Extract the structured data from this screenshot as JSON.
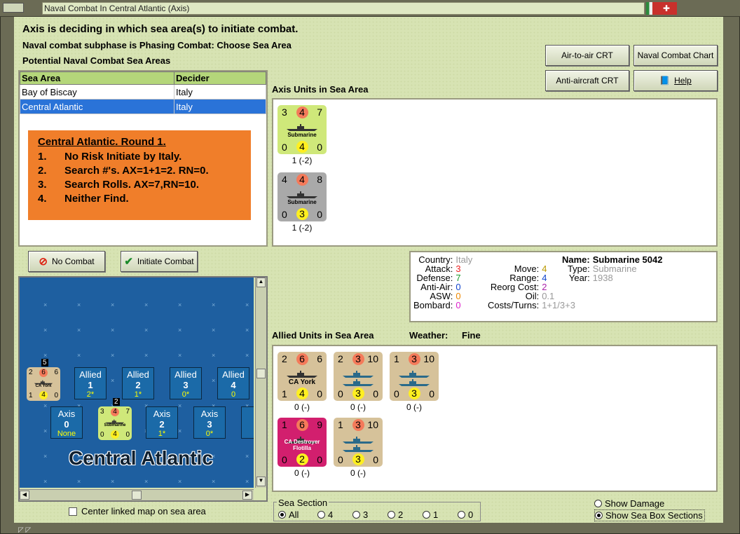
{
  "window": {
    "title": "Naval Combat In Central Atlantic (Axis)"
  },
  "status": {
    "line1": "Axis is deciding in which sea area(s) to initiate combat.",
    "line2": "Naval combat subphase is Phasing Combat: Choose Sea Area",
    "line3": "Potential Naval Combat Sea Areas"
  },
  "buttons": {
    "air_crt": "Air-to-air CRT",
    "naval_chart": "Naval Combat Chart",
    "aa_crt": "Anti-aircraft CRT",
    "help": "Help",
    "no_combat": "No Combat",
    "initiate": "Initiate Combat"
  },
  "sea_table": {
    "headers": [
      "Sea Area",
      "Decider"
    ],
    "rows": [
      [
        "Bay of Biscay",
        "Italy"
      ],
      [
        "Central Atlantic",
        "Italy"
      ]
    ]
  },
  "report": {
    "title": "Central Atlantic.  Round 1.",
    "lines": [
      [
        "1.",
        "No Risk Initiate by Italy."
      ],
      [
        "2.",
        "Search #'s.  AX=1+1=2.  RN=0."
      ],
      [
        "3.",
        "Search Rolls.  AX=7,RN=10."
      ],
      [
        "4.",
        "Neither Find."
      ]
    ]
  },
  "axis_units": {
    "label": "Axis Units in Sea Area",
    "units": [
      {
        "tl": "3",
        "tc": "4",
        "tr": "7",
        "name": "Submarine",
        "bl": "0",
        "bc": "4",
        "br": "0",
        "cap": "1 (-2)",
        "color": "#cfe87a"
      },
      {
        "tl": "4",
        "tc": "4",
        "tr": "8",
        "name": "Submarine",
        "bl": "0",
        "bc": "3",
        "br": "0",
        "cap": "1 (-2)",
        "color": "#a9a9a9"
      }
    ]
  },
  "info": {
    "country_l": "Country:",
    "country": "Italy",
    "attack_l": "Attack:",
    "attack": "3",
    "defense_l": "Defense:",
    "defense": "7",
    "aa_l": "Anti-Air:",
    "aa": "0",
    "asw_l": "ASW:",
    "asw": "0",
    "bombard_l": "Bombard:",
    "bombard": "0",
    "move_l": "Move:",
    "move": "4",
    "range_l": "Range:",
    "range": "4",
    "reorg_l": "Reorg Cost:",
    "reorg": "2",
    "oil_l": "Oil:",
    "oil": "0.1",
    "costs_l": "Costs/Turns:",
    "costs": "1+1/3+3",
    "name_l": "Name:",
    "name": "Submarine 5042",
    "type_l": "Type:",
    "type": "Submarine",
    "year_l": "Year:",
    "year": "1938"
  },
  "allied_units": {
    "label": "Allied Units in Sea Area",
    "weather_l": "Weather:",
    "weather": "Fine",
    "units": [
      {
        "tl": "2",
        "tc": "6",
        "tr": "6",
        "name": "CA York",
        "bl": "1",
        "bc": "4",
        "br": "0",
        "cap": "0 (-)",
        "color": "#d6c29a"
      },
      {
        "tl": "2",
        "tc": "3",
        "tr": "10",
        "name": "",
        "bl": "0",
        "bc": "3",
        "br": "0",
        "cap": "0 (-)",
        "color": "#d6c29a"
      },
      {
        "tl": "1",
        "tc": "3",
        "tr": "10",
        "name": "",
        "bl": "0",
        "bc": "3",
        "br": "0",
        "cap": "0 (-)",
        "color": "#d6c29a"
      },
      {
        "tl": "1",
        "tc": "6",
        "tr": "9",
        "name": "CA Destroyer Flotilla",
        "bl": "0",
        "bc": "2",
        "br": "0",
        "cap": "0 (-)",
        "color": "#d21f6e"
      },
      {
        "tl": "1",
        "tc": "3",
        "tr": "10",
        "name": "",
        "bl": "0",
        "bc": "3",
        "br": "0",
        "cap": "0 (-)",
        "color": "#d6c29a"
      }
    ]
  },
  "map": {
    "sea_name": "Central Atlantic",
    "allied_boxes": [
      {
        "a": "Allied",
        "b": "1",
        "c": "2*"
      },
      {
        "a": "Allied",
        "b": "2",
        "c": "1*"
      },
      {
        "a": "Allied",
        "b": "3",
        "c": "0*"
      },
      {
        "a": "Allied",
        "b": "4",
        "c": "0"
      }
    ],
    "axis_boxes": [
      {
        "a": "Axis",
        "b": "0",
        "c": "None"
      },
      {
        "a": "Axis",
        "b": "2",
        "c": "1*"
      },
      {
        "a": "Axis",
        "b": "3",
        "c": "0*"
      },
      {
        "a": "A",
        "b": "",
        "c": ""
      }
    ],
    "york_stack": "5",
    "sub_stack": "2",
    "york": {
      "tl": "2",
      "tc": "6",
      "tr": "6",
      "name": "CA York",
      "bl": "1",
      "bc": "4",
      "br": "0"
    },
    "sub": {
      "tl": "3",
      "tc": "4",
      "tr": "7",
      "name": "Submarine",
      "bl": "0",
      "bc": "4",
      "br": "0"
    }
  },
  "center_map": "Center linked map on sea area",
  "sea_section": {
    "label": "Sea Section",
    "options": [
      "All",
      "4",
      "3",
      "2",
      "1",
      "0"
    ],
    "selected": "All"
  },
  "show_damage": "Show Damage",
  "show_sections": "Show Sea Box Sections",
  "colors": {
    "panel_bg": "#d7e3b3",
    "sea": "#1e5fa0",
    "orange": "#f07e2a",
    "select": "#2a73d8"
  }
}
